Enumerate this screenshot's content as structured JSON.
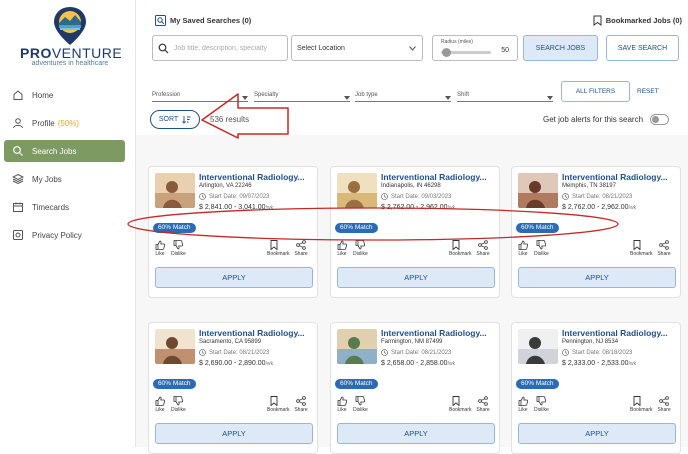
{
  "sidebar": {
    "brand_pro": "PRO",
    "brand_venture": "VENTURE",
    "tagline": "adventures in healthcare",
    "items": [
      {
        "label": "Home",
        "icon": "home-icon"
      },
      {
        "label": "Profile",
        "badge": "(50%)",
        "icon": "user-icon"
      },
      {
        "label": "Search Jobs",
        "icon": "search-icon",
        "active": true
      },
      {
        "label": "My Jobs",
        "icon": "layers-icon"
      },
      {
        "label": "Timecards",
        "icon": "calendar-icon"
      },
      {
        "label": "Privacy Policy",
        "icon": "privacy-icon"
      }
    ]
  },
  "header": {
    "saved_searches": "My Saved Searches (0)",
    "bookmarked_jobs": "Bookmarked Jobs (0)"
  },
  "search": {
    "placeholder": "Job title, description, specialty",
    "location_value": "Select Location",
    "radius_label": "Radius (miles)",
    "radius_value": "50",
    "search_button": "SEARCH JOBS",
    "save_button": "SAVE SEARCH"
  },
  "filters": {
    "profession": "Profession",
    "specialty": "Specialty",
    "job_type": "Job type",
    "shift": "Shift",
    "all_filters": "ALL FILTERS",
    "reset": "RESET"
  },
  "results": {
    "sort": "SORT",
    "count": "536 results",
    "alerts_label": "Get job alerts for this search"
  },
  "cards": [
    {
      "title": "Interventional Radiology...",
      "location": "Arlington, VA 22246",
      "start": "Start Date: 09/07/2023",
      "pay": "$ 2,841.00 - 3,041.00",
      "per": "/wk",
      "match": "60% Match"
    },
    {
      "title": "Interventional Radiology...",
      "location": "Indianapolis, IN 46298",
      "start": "Start Date: 09/03/2023",
      "pay": "$ 2,762.00 - 2,962.00",
      "per": "/wk",
      "match": "60% Match"
    },
    {
      "title": "Interventional Radiology...",
      "location": "Memphis, TN 38197",
      "start": "Start Date: 08/21/2023",
      "pay": "$ 2,762.00 - 2,962.00",
      "per": "/wk",
      "match": "60% Match"
    },
    {
      "title": "Interventional Radiology...",
      "location": "Sacramento, CA 95899",
      "start": "Start Date: 08/21/2023",
      "pay": "$ 2,690.00 - 2,890.00",
      "per": "/wk",
      "match": "60% Match"
    },
    {
      "title": "Interventional Radiology...",
      "location": "Farmington, NM 87499",
      "start": "Start Date: 08/21/2023",
      "pay": "$ 2,658.00 - 2,858.00",
      "per": "/wk",
      "match": "60% Match"
    },
    {
      "title": "Interventional Radiology...",
      "location": "Pennington, NJ 8534",
      "start": "Start Date: 08/18/2023",
      "pay": "$ 2,333.00 - 2,533.00",
      "per": "/wk",
      "match": "60% Match"
    }
  ],
  "card_actions": {
    "like": "Like",
    "dislike": "Dislike",
    "bookmark": "Bookmark",
    "share": "Share",
    "apply": "APPLY"
  },
  "colors": {
    "accent": "#1f4f8a",
    "active_nav": "#7d9a62",
    "match_badge": "#2a6bb5",
    "annotation": "#c62828"
  }
}
